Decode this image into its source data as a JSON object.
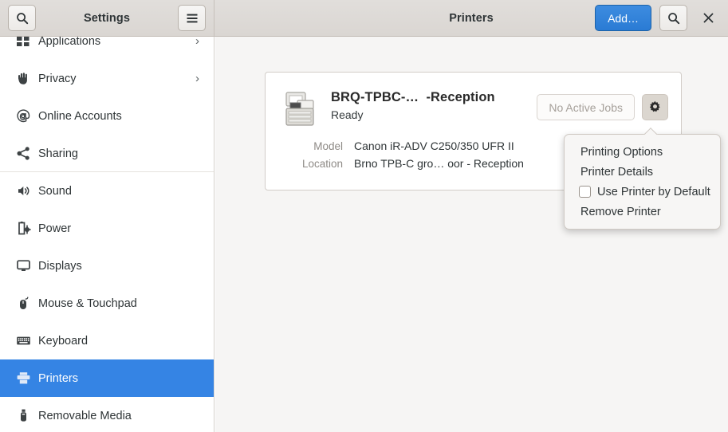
{
  "window": {
    "sidebar_title": "Settings",
    "content_title": "Printers",
    "close_label": "×"
  },
  "header": {
    "search_left_icon": "search-icon",
    "menu_icon": "hamburger-menu-icon",
    "add_label": "Add…",
    "search_right_icon": "search-icon",
    "accent_color": "#3584e4"
  },
  "sidebar": {
    "items": [
      {
        "label": "Applications",
        "icon": "applications-icon",
        "chevron": "›",
        "selected": false,
        "separator_after": false,
        "clipped": true
      },
      {
        "label": "Privacy",
        "icon": "hand-icon",
        "chevron": "›",
        "selected": false,
        "separator_after": false
      },
      {
        "label": "Online Accounts",
        "icon": "at-sign-icon",
        "chevron": "",
        "selected": false,
        "separator_after": false
      },
      {
        "label": "Sharing",
        "icon": "share-nodes-icon",
        "chevron": "",
        "selected": false,
        "separator_after": true
      },
      {
        "label": "Sound",
        "icon": "speaker-icon",
        "chevron": "",
        "selected": false,
        "separator_after": false
      },
      {
        "label": "Power",
        "icon": "battery-plug-icon",
        "chevron": "",
        "selected": false,
        "separator_after": false
      },
      {
        "label": "Displays",
        "icon": "monitor-icon",
        "chevron": "",
        "selected": false,
        "separator_after": false
      },
      {
        "label": "Mouse & Touchpad",
        "icon": "mouse-icon",
        "chevron": "",
        "selected": false,
        "separator_after": false
      },
      {
        "label": "Keyboard",
        "icon": "keyboard-icon",
        "chevron": "",
        "selected": false,
        "separator_after": false
      },
      {
        "label": "Printers",
        "icon": "printer-icon",
        "chevron": "",
        "selected": true,
        "separator_after": false
      },
      {
        "label": "Removable Media",
        "icon": "usb-stick-icon",
        "chevron": "",
        "selected": false,
        "separator_after": false
      }
    ]
  },
  "printer_card": {
    "icon": "multifunction-printer-icon",
    "name": "BRQ-TPBC-…  -Reception",
    "status": "Ready",
    "jobs_button_label": "No Active Jobs",
    "gear_icon": "gear-icon",
    "fields": [
      {
        "label": "Model",
        "value": "Canon iR-ADV C250/350 UFR II"
      },
      {
        "label": "Location",
        "value": "Brno TPB-C gro… oor - Reception"
      }
    ]
  },
  "printer_menu": {
    "items": [
      {
        "label": "Printing Options",
        "type": "item"
      },
      {
        "label": "Printer Details",
        "type": "item"
      },
      {
        "label": "Use Printer by Default",
        "type": "checkbox",
        "checked": false
      },
      {
        "label": "Remove Printer",
        "type": "item"
      }
    ]
  }
}
